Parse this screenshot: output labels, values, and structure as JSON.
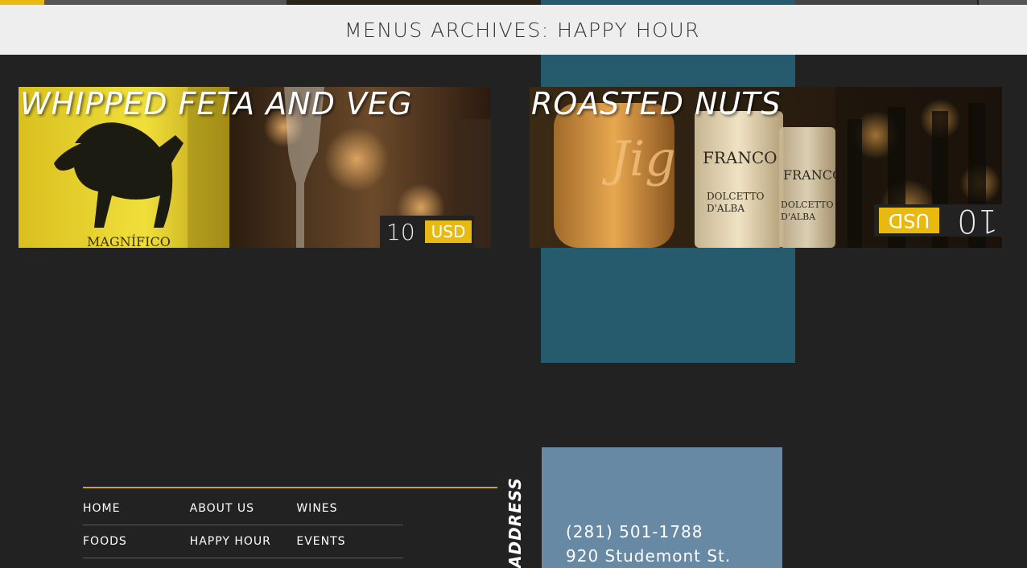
{
  "colors": {
    "accent_gold": "#e8b911",
    "teal": "#265b6e",
    "contact_blue": "#6889a3",
    "header_bg": "#eeeeee",
    "page_bg": "#222222"
  },
  "header": {
    "title": "MENUS ARCHIVES: HAPPY HOUR"
  },
  "menu_items": [
    {
      "title": "WHIPPED FETA AND VEG",
      "price": "10",
      "currency": "USD"
    },
    {
      "title": "ROASTED NUTS",
      "price": "10",
      "currency": "USD"
    }
  ],
  "footer": {
    "nav": [
      [
        "HOME",
        "ABOUT US",
        "WINES"
      ],
      [
        "FOODS",
        "HAPPY HOUR",
        "EVENTS"
      ]
    ],
    "address_label": "ADDRESS",
    "phone": "(281) 501-1788",
    "street": "920 Studemont St."
  }
}
